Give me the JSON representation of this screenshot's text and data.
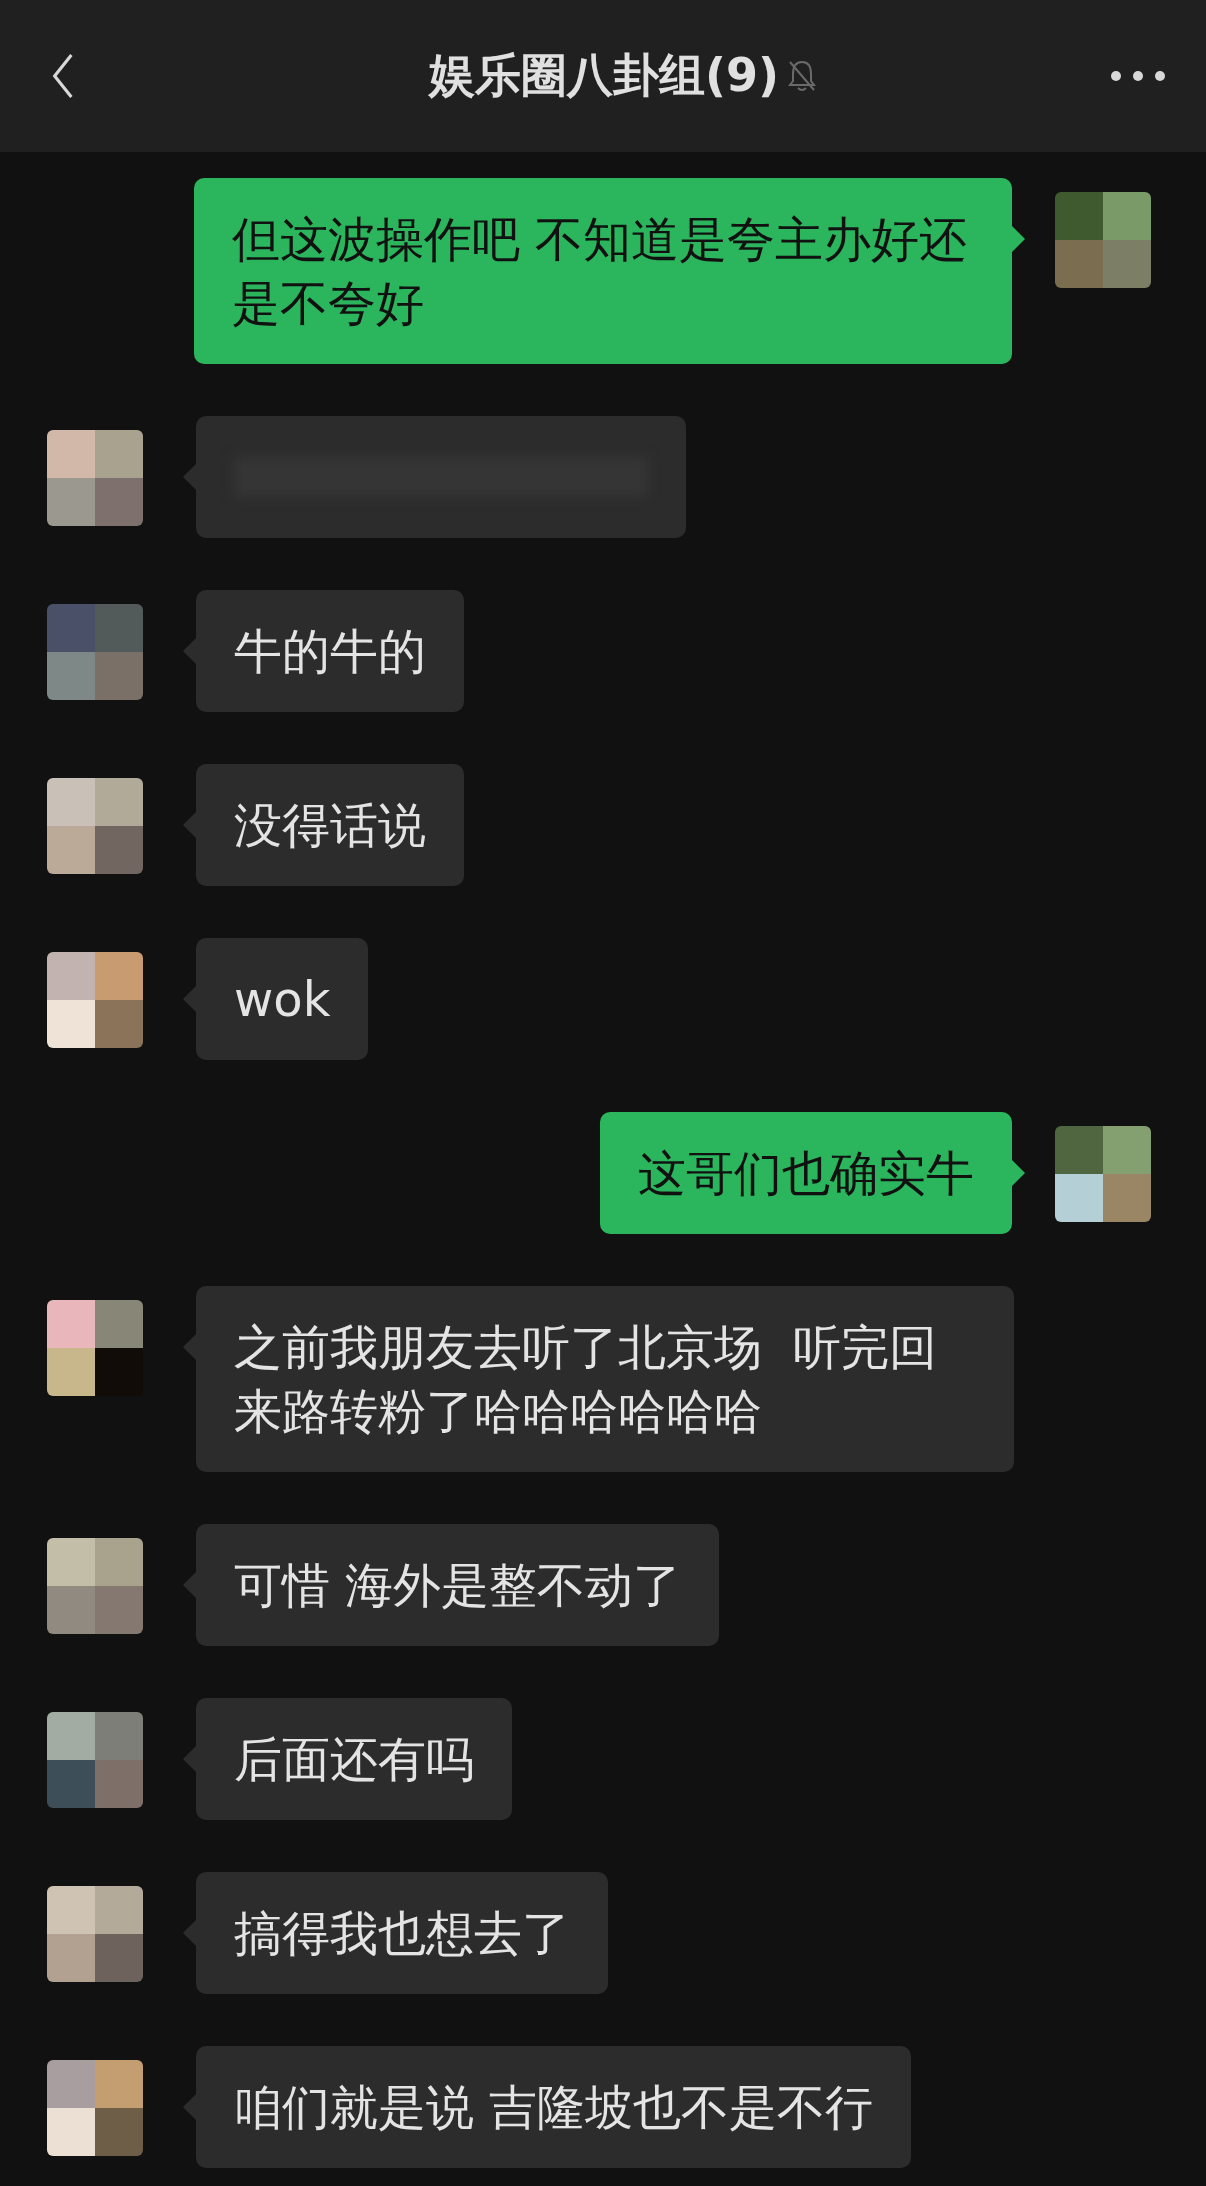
{
  "header": {
    "title": "娱乐圈八卦组(9)",
    "muted": true
  },
  "messages": [
    {
      "outgoing": true,
      "kind": "text",
      "text": "但这波操作吧 不知道是夸主办好还是不夸好"
    },
    {
      "outgoing": false,
      "kind": "redacted"
    },
    {
      "outgoing": false,
      "kind": "text",
      "text": "牛的牛的"
    },
    {
      "outgoing": false,
      "kind": "text",
      "text": "没得话说"
    },
    {
      "outgoing": false,
      "kind": "text",
      "text": "wok"
    },
    {
      "outgoing": true,
      "kind": "text",
      "text": "这哥们也确实牛"
    },
    {
      "outgoing": false,
      "kind": "text",
      "text": "之前我朋友去听了北京场  听完回来路转粉了哈哈哈哈哈哈"
    },
    {
      "outgoing": false,
      "kind": "text",
      "text": "可惜 海外是整不动了"
    },
    {
      "outgoing": false,
      "kind": "text",
      "text": "后面还有吗"
    },
    {
      "outgoing": false,
      "kind": "text",
      "text": "搞得我也想去了"
    },
    {
      "outgoing": false,
      "kind": "text",
      "text": "咱们就是说 吉隆坡也不是不行"
    }
  ]
}
